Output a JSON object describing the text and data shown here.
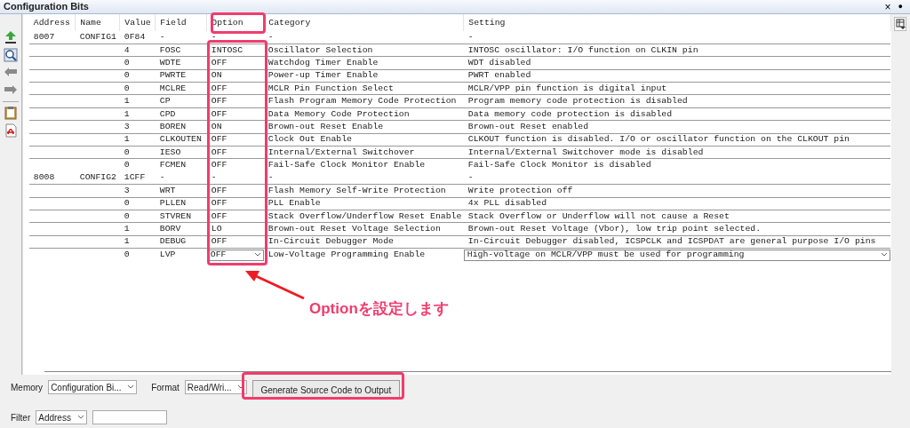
{
  "panel": {
    "title": "Configuration Bits",
    "buttons": [
      "×",
      "●"
    ]
  },
  "table": {
    "columns": [
      "Address",
      "Name",
      "Value",
      "Field",
      "Option",
      "Category",
      "Setting"
    ],
    "rows": [
      {
        "kind": "register",
        "cells": [
          "8007",
          "CONFIG1",
          "0F84",
          "-",
          "-",
          "-",
          "-"
        ]
      },
      {
        "kind": "field",
        "cells": [
          "",
          "",
          "4",
          "FOSC",
          "INTOSC",
          "Oscillator Selection",
          "INTOSC oscillator: I/O function on CLKIN pin"
        ]
      },
      {
        "kind": "field",
        "cells": [
          "",
          "",
          "0",
          "WDTE",
          "OFF",
          "Watchdog Timer Enable",
          "WDT disabled"
        ]
      },
      {
        "kind": "field",
        "cells": [
          "",
          "",
          "0",
          "PWRTE",
          "ON",
          "Power-up Timer Enable",
          "PWRT enabled"
        ]
      },
      {
        "kind": "field",
        "cells": [
          "",
          "",
          "0",
          "MCLRE",
          "OFF",
          "MCLR Pin Function Select",
          "MCLR/VPP pin function is digital input"
        ]
      },
      {
        "kind": "field",
        "cells": [
          "",
          "",
          "1",
          "CP",
          "OFF",
          "Flash Program Memory Code Protection",
          "Program memory code protection is disabled"
        ]
      },
      {
        "kind": "field",
        "cells": [
          "",
          "",
          "1",
          "CPD",
          "OFF",
          "Data Memory Code Protection",
          "Data memory code protection is disabled"
        ]
      },
      {
        "kind": "field",
        "cells": [
          "",
          "",
          "3",
          "BOREN",
          "ON",
          "Brown-out Reset Enable",
          "Brown-out Reset enabled"
        ]
      },
      {
        "kind": "field",
        "cells": [
          "",
          "",
          "1",
          "CLKOUTEN",
          "OFF",
          "Clock Out Enable",
          "CLKOUT function is disabled. I/O or oscillator function on the CLKOUT pin"
        ]
      },
      {
        "kind": "field",
        "cells": [
          "",
          "",
          "0",
          "IESO",
          "OFF",
          "Internal/External Switchover",
          "Internal/External Switchover mode is disabled"
        ]
      },
      {
        "kind": "field",
        "cells": [
          "",
          "",
          "0",
          "FCMEN",
          "OFF",
          "Fail-Safe Clock Monitor Enable",
          "Fail-Safe Clock Monitor is disabled"
        ]
      },
      {
        "kind": "register",
        "cells": [
          "8008",
          "CONFIG2",
          "1CFF",
          "-",
          "-",
          "-",
          "-"
        ]
      },
      {
        "kind": "field",
        "cells": [
          "",
          "",
          "3",
          "WRT",
          "OFF",
          "Flash Memory Self-Write Protection",
          "Write protection off"
        ]
      },
      {
        "kind": "field",
        "cells": [
          "",
          "",
          "0",
          "PLLEN",
          "OFF",
          "PLL Enable",
          "4x PLL disabled"
        ]
      },
      {
        "kind": "field",
        "cells": [
          "",
          "",
          "0",
          "STVREN",
          "OFF",
          "Stack Overflow/Underflow Reset Enable",
          "Stack Overflow or Underflow will not cause a Reset"
        ]
      },
      {
        "kind": "field",
        "cells": [
          "",
          "",
          "1",
          "BORV",
          "LO",
          "Brown-out Reset Voltage Selection",
          "Brown-out Reset Voltage (Vbor), low trip point selected."
        ]
      },
      {
        "kind": "field",
        "cells": [
          "",
          "",
          "1",
          "DEBUG",
          "OFF",
          "In-Circuit Debugger Mode",
          "In-Circuit Debugger disabled, ICSPCLK and ICSPDAT are general purpose I/O pins"
        ]
      },
      {
        "kind": "editing",
        "cells": [
          "",
          "",
          "0",
          "LVP",
          "OFF",
          "Low-Voltage Programming Enable",
          "High-voltage on MCLR/VPP must be used for programming"
        ]
      }
    ]
  },
  "memory": {
    "label": "Memory",
    "value": "Configuration Bi..."
  },
  "format": {
    "label": "Format",
    "value": "Read/Wri..."
  },
  "generate_button": "Generate Source Code to Output",
  "filter": {
    "label": "Filter",
    "value": "Address"
  },
  "annotation": "Optionを設定します"
}
